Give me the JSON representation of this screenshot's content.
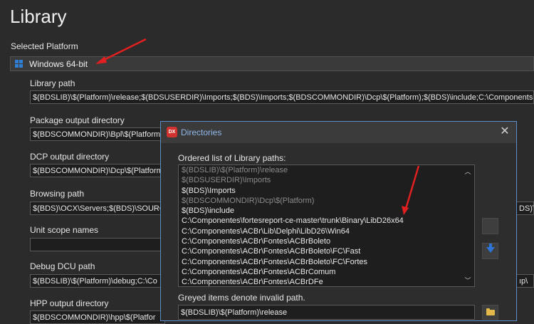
{
  "page": {
    "title": "Library",
    "selected_platform_label": "Selected Platform",
    "platform_value": "Windows 64-bit"
  },
  "fields": [
    {
      "label": "Library path",
      "value": "$(BDSLIB)\\$(Platform)\\release;$(BDSUSERDIR)\\Imports;$(BDS)\\Imports;$(BDSCOMMONDIR)\\Dcp\\$(Platform);$(BDS)\\include;C:\\Components"
    },
    {
      "label": "Package output directory",
      "value": "$(BDSCOMMONDIR)\\Bpl\\$(Platform"
    },
    {
      "label": "DCP output directory",
      "value": "$(BDSCOMMONDIR)\\Dcp\\$(Platform"
    },
    {
      "label": "Browsing path",
      "value": "$(BDS)\\OCX\\Servers;$(BDS)\\SOURCE",
      "tail": "DS)\\s"
    },
    {
      "label": "Unit scope names",
      "value": ""
    },
    {
      "label": "Debug DCU path",
      "value": "$(BDSLIB)\\$(Platform)\\debug;C:\\Co",
      "tail": "ıp\\"
    },
    {
      "label": "HPP output directory",
      "value": "$(BDSCOMMONDIR)\\hpp\\$(Platfor"
    }
  ],
  "dialog": {
    "icon_text": "DX",
    "title": "Directories",
    "close_glyph": "✕",
    "list_label": "Ordered list of Library paths:",
    "items": [
      {
        "text": "$(BDSLIB)\\$(Platform)\\release",
        "invalid": true
      },
      {
        "text": "$(BDSUSERDIR)\\Imports",
        "invalid": true
      },
      {
        "text": "$(BDS)\\Imports",
        "invalid": false
      },
      {
        "text": "$(BDSCOMMONDIR)\\Dcp\\$(Platform)",
        "invalid": true
      },
      {
        "text": "$(BDS)\\include",
        "invalid": false
      },
      {
        "text": "C:\\Componentes\\fortesreport-ce-master\\trunk\\Binary\\LibD26x64",
        "invalid": false
      },
      {
        "text": "C:\\Componentes\\ACBr\\Lib\\Delphi\\LibD26\\Win64",
        "invalid": false
      },
      {
        "text": "C:\\Componentes\\ACBr\\Fontes\\ACBrBoleto",
        "invalid": false
      },
      {
        "text": "C:\\Componentes\\ACBr\\Fontes\\ACBrBoleto\\FC\\Fast",
        "invalid": false
      },
      {
        "text": "C:\\Componentes\\ACBr\\Fontes\\ACBrBoleto\\FC\\Fortes",
        "invalid": false
      },
      {
        "text": "C:\\Componentes\\ACBr\\Fontes\\ACBrComum",
        "invalid": false
      },
      {
        "text": "C:\\Componentes\\ACBr\\Fontes\\ACBrDFe",
        "invalid": false
      }
    ],
    "hint": "Greyed items denote invalid path.",
    "edit_value": "$(BDSLIB)\\$(Platform)\\release"
  },
  "colors": {
    "annotation_arrow": "#e02020",
    "accent": "#2e73d6"
  }
}
